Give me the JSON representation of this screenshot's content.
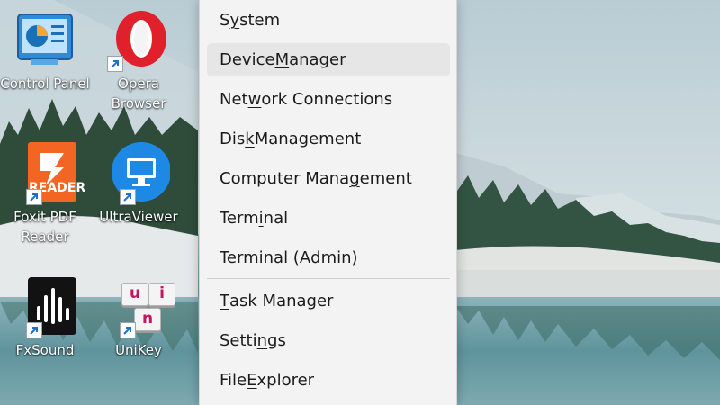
{
  "desktop_icons": [
    {
      "id": "control-panel",
      "label_lines": [
        "Control Panel"
      ],
      "shortcut": false
    },
    {
      "id": "opera",
      "label_lines": [
        "Opera",
        "Browser"
      ],
      "shortcut": true
    },
    {
      "id": "foxit",
      "label_lines": [
        "Foxit PDF",
        "Reader"
      ],
      "shortcut": true,
      "badge": "READER"
    },
    {
      "id": "ultraviewer",
      "label_lines": [
        "UltraViewer"
      ],
      "shortcut": true
    },
    {
      "id": "fxsound",
      "label_lines": [
        "FxSound"
      ],
      "shortcut": true
    },
    {
      "id": "unikey",
      "label_lines": [
        "UniKey"
      ],
      "shortcut": true,
      "keys": [
        "u",
        "i",
        "n"
      ]
    }
  ],
  "menu": {
    "items": [
      {
        "label": "System",
        "pre": "S",
        "key": "y",
        "post": "stem"
      },
      {
        "label": "Device Manager",
        "pre": "Device ",
        "key": "M",
        "post": "anager",
        "highlighted": true
      },
      {
        "label": "Network Connections",
        "pre": "Net",
        "key": "w",
        "post": "ork Connections"
      },
      {
        "label": "Disk Management",
        "pre": "Dis",
        "key": "k",
        "post": " Management"
      },
      {
        "label": "Computer Management",
        "pre": "Computer Mana",
        "key": "g",
        "post": "ement"
      },
      {
        "label": "Terminal",
        "pre": "Term",
        "key": "i",
        "post": "nal"
      },
      {
        "label": "Terminal (Admin)",
        "pre": "Terminal (",
        "key": "A",
        "post": "dmin)"
      },
      {
        "label": "Task Manager",
        "pre": "",
        "key": "T",
        "post": "ask Manager"
      },
      {
        "label": "Settings",
        "pre": "Setti",
        "key": "n",
        "post": "gs"
      },
      {
        "label": "File Explorer",
        "pre": "File ",
        "key": "E",
        "post": "xplorer"
      }
    ]
  },
  "colors": {
    "menu_bg": "#f3f3f3",
    "menu_highlight": "#e6e6e6",
    "opera_red": "#e0202b",
    "foxit_orange": "#f26522",
    "ultraviewer_blue": "#1e88e5"
  }
}
